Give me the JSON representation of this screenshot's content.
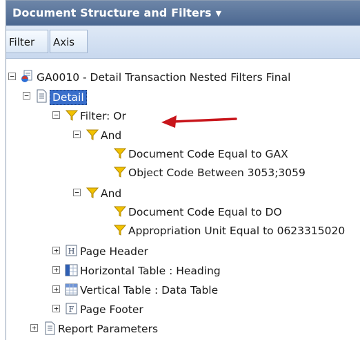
{
  "panel": {
    "title": "Document Structure and Filters",
    "title_caret": "▼"
  },
  "tabs": [
    {
      "label": "Filter"
    },
    {
      "label": "Axis"
    }
  ],
  "tree": {
    "root": {
      "label": "GA0010 - Detail Transaction Nested Filters Final"
    },
    "detail": {
      "label": "Detail"
    },
    "filter_or": {
      "label": "Filter: Or"
    },
    "and_1": {
      "label": "And"
    },
    "cond_1": {
      "label": "Document Code Equal to GAX"
    },
    "cond_2": {
      "label": "Object Code Between 3053;3059"
    },
    "and_2": {
      "label": "And"
    },
    "cond_3": {
      "label": "Document Code Equal to DO"
    },
    "cond_4": {
      "label": "Appropriation Unit Equal to 0623315020"
    },
    "page_header": {
      "label": "Page Header"
    },
    "horizontal_table": {
      "label": "Horizontal Table : Heading"
    },
    "vertical_table": {
      "label": "Vertical Table : Data Table"
    },
    "page_footer": {
      "label": "Page Footer"
    },
    "report_params": {
      "label": "Report Parameters"
    }
  },
  "expander_symbol": "−",
  "expander_plus": "+",
  "colors": {
    "title_bar": "#4b6790",
    "selection": "#3a6fcb",
    "funnel": "#f2c200",
    "arrow": "#c8151b"
  }
}
